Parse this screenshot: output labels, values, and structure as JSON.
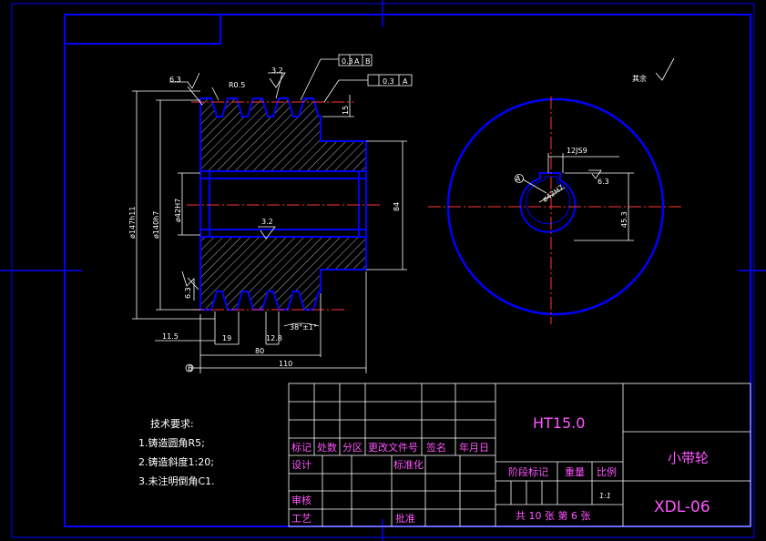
{
  "title_block": {
    "material": "HT15.0",
    "part_name": "小带轮",
    "drawing_no": "XDL-06",
    "sheet_info": "共 10 张 第 6 张",
    "scale": "1:1",
    "headers": {
      "mark": "标记",
      "count": "处数",
      "zone": "分区",
      "change_doc": "更改文件号",
      "sign": "签名",
      "date": "年月日",
      "design": "设计",
      "standardize": "标准化",
      "stage_mark": "阶段标记",
      "weight": "重量",
      "ratio": "比例",
      "review": "审核",
      "process": "工艺",
      "approve": "批准"
    }
  },
  "technical_requirements": {
    "heading": "技术要求:",
    "items": [
      "1.铸造圆角R5;",
      "2.铸造斜度1:20;",
      "3.未注明倒角C1."
    ]
  },
  "surface_finish": {
    "rest_label": "其余",
    "values": [
      "6.3",
      "3.2",
      "3.2",
      "6.3",
      "6.3"
    ]
  },
  "dimensions": {
    "groove_radius": "R0.5",
    "tolerance_frame_1": [
      "0.3",
      "A",
      "B"
    ],
    "tolerance_frame_2": [
      "0.3",
      "A"
    ],
    "groove_depth": "15",
    "outer_dia": "ø147h11",
    "pitch_dia": "ø140h7",
    "bore_dia": "ø42H7",
    "hub_length": "84",
    "groove_offset": "11.5",
    "groove_pitch": "19",
    "groove_width": "12.8",
    "groove_angle": "38°±1°",
    "grooved_width": "80",
    "total_width": "110",
    "keyway_width": "12JS9",
    "keyway_depth": "45.3",
    "bore_side": "ø42H7",
    "datum_a": "A",
    "datum_b": "B"
  }
}
